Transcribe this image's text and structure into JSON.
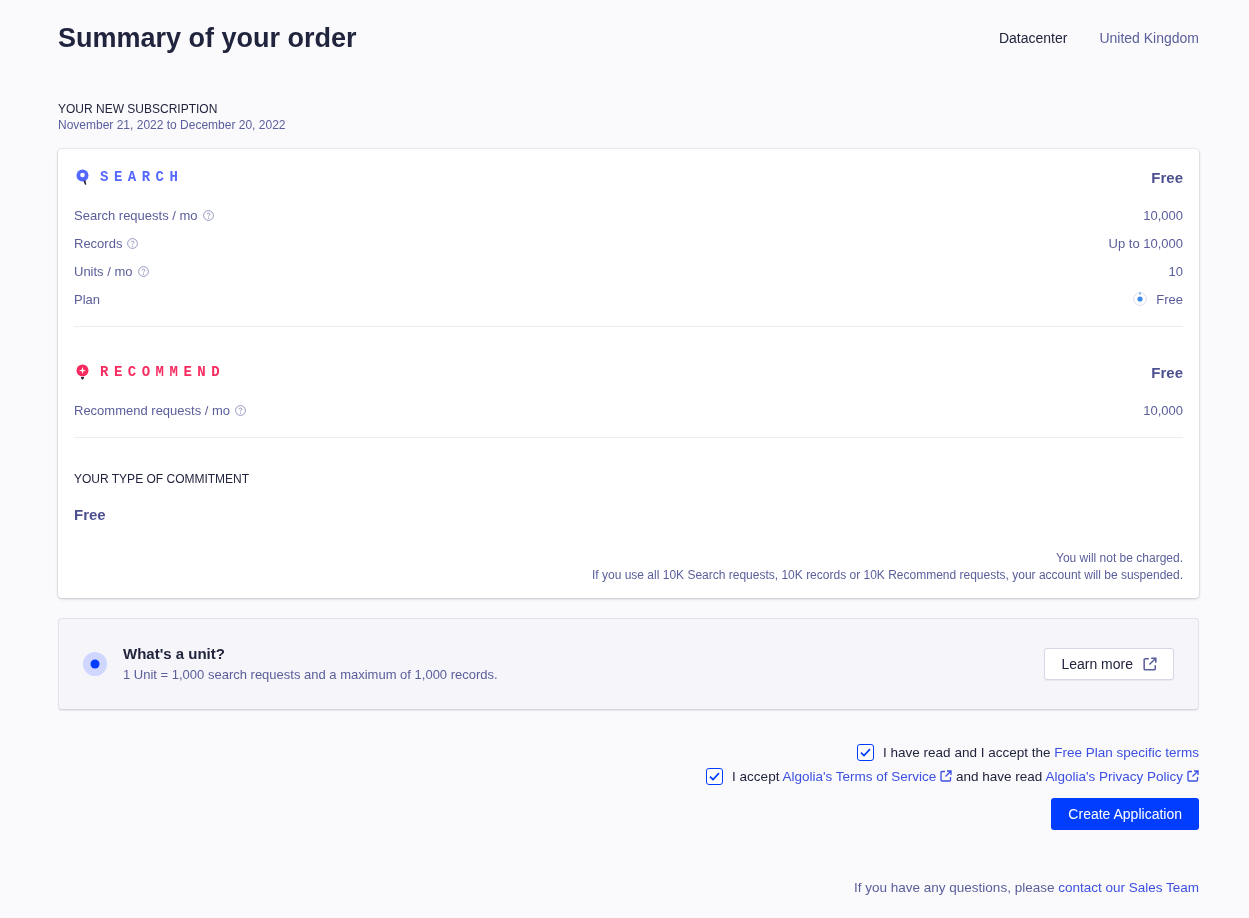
{
  "header": {
    "title": "Summary of your order",
    "datacenter": {
      "label": "Datacenter",
      "value": "United Kingdom"
    }
  },
  "subscription": {
    "heading": "YOUR NEW SUBSCRIPTION",
    "period": "November 21, 2022 to December 20, 2022"
  },
  "products": [
    {
      "kind": "search",
      "name": "SEARCH",
      "color": "#5468ff",
      "price": "Free",
      "rows": [
        {
          "kind": "metric",
          "label": "Search requests / mo",
          "help": true,
          "value": "10,000"
        },
        {
          "kind": "metric",
          "label": "Records",
          "help": true,
          "value": "Up to 10,000"
        },
        {
          "kind": "metric",
          "label": "Units / mo",
          "help": true,
          "value": "10"
        },
        {
          "kind": "plan",
          "label": "Plan",
          "help": false,
          "value": "Free"
        }
      ]
    },
    {
      "kind": "recommend",
      "name": "RECOMMEND",
      "color": "#f82b60",
      "price": "Free",
      "rows": [
        {
          "kind": "metric",
          "label": "Recommend requests / mo",
          "help": true,
          "value": "10,000"
        }
      ]
    }
  ],
  "commitment": {
    "heading": "YOUR TYPE OF COMMITMENT",
    "value": "Free",
    "notes": [
      "You will not be charged.",
      "If you use all 10K Search requests, 10K records or 10K Recommend requests, your account will be suspended."
    ]
  },
  "unit_info": {
    "title": "What's a unit?",
    "description": "1 Unit = 1,000 search requests and a maximum of 1,000 records.",
    "button": "Learn more"
  },
  "terms": [
    {
      "checked": true,
      "parts": [
        {
          "kind": "text",
          "text": "I have read and I accept the "
        },
        {
          "kind": "link",
          "text": "Free Plan specific terms"
        }
      ]
    },
    {
      "checked": true,
      "parts": [
        {
          "kind": "text",
          "text": "I accept "
        },
        {
          "kind": "external_link",
          "text": "Algolia's Terms of Service"
        },
        {
          "kind": "text",
          "text": " and have read "
        },
        {
          "kind": "external_link",
          "text": "Algolia's Privacy Policy"
        }
      ]
    }
  ],
  "create_button": "Create Application",
  "footer": {
    "parts": [
      {
        "kind": "text",
        "text": "If you have any questions, please "
      },
      {
        "kind": "link",
        "text": "contact our Sales Team"
      }
    ]
  }
}
